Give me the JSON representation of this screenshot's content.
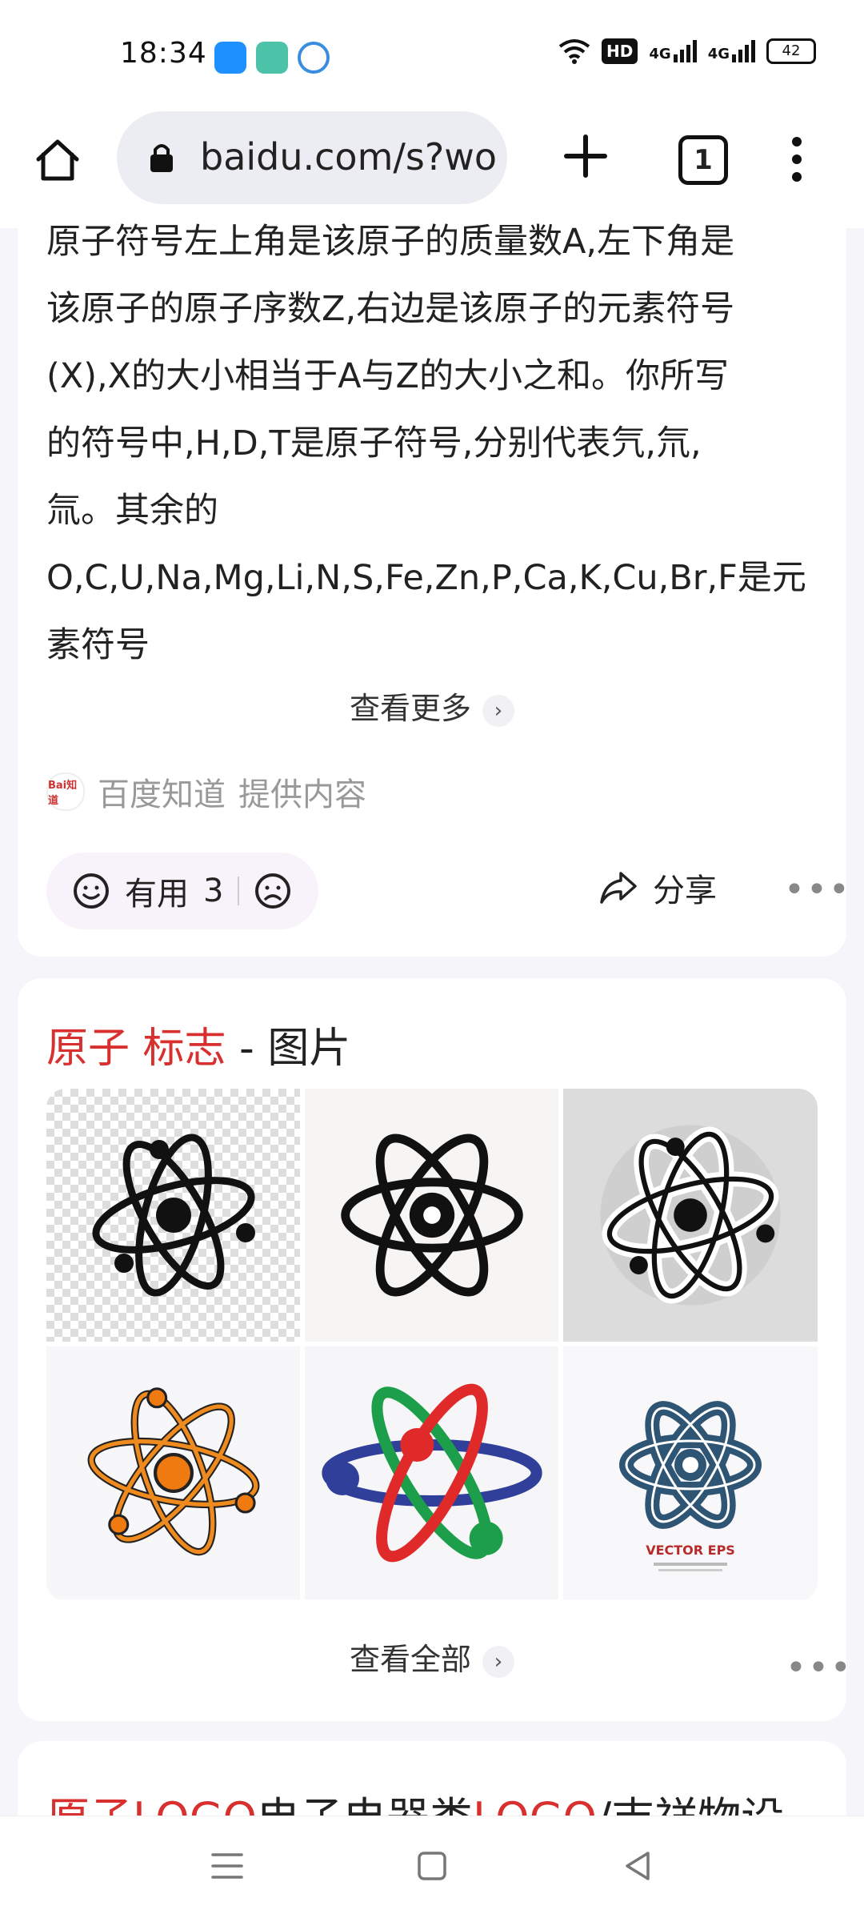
{
  "status_bar": {
    "time": "18:34",
    "hd_label": "HD",
    "net1": "4G",
    "net2": "4G",
    "battery": "42",
    "app_icon_colors": [
      "#1e90ff",
      "#4cc3a8",
      "#3a8dde"
    ]
  },
  "browser": {
    "url": "baidu.com/s?wo",
    "tab_count": "1"
  },
  "answer_card": {
    "text": "原子符号左上角是该原子的质量数A,左下角是\n该原子的原子序数Z,右边是该原子的元素符号\n(X),X的大小相当于A与Z的大小之和。你所写\n的符号中,H,D,T是原子符号,分别代表氕,氘,\n氚。其余的\nO,C,U,Na,Mg,Li,N,S,Fe,Zn,P,Ca,K,Cu,Br,F是元\n素符号",
    "see_more": "查看更多",
    "source_name": "百度知道",
    "source_suffix": "提供内容",
    "source_logo_text": "Bai知道",
    "useful_label": "有用",
    "useful_count": "3",
    "share_label": "分享"
  },
  "image_card": {
    "title_hl": "原子 标志",
    "title_rest": " - 图片",
    "view_all": "查看全部",
    "image_names": [
      "atom-logo-black-checker",
      "atom-logo-black-outline",
      "atom-logo-sticker",
      "atom-logo-orange",
      "atom-logo-colorful",
      "atom-logo-blue-vector"
    ],
    "vector_caption": "VECTOR EPS"
  },
  "next_card": {
    "title_hl1": "原子LOGO",
    "title_mid": "电子电器类",
    "title_hl2": "LOGO",
    "title_rest": "/吉祥物设"
  },
  "colors": {
    "highlight": "#d8302f",
    "page_bg": "#f5f5fa"
  }
}
